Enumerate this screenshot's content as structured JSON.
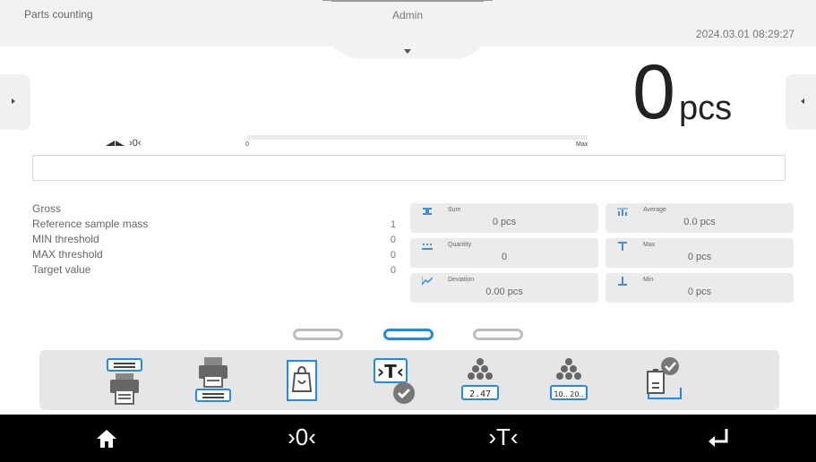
{
  "header": {
    "mode": "Parts counting",
    "user": "Admin",
    "datetime": "2024.03.01 08:29:27"
  },
  "result": {
    "value": "0",
    "unit": "pcs"
  },
  "indicators": {
    "zero": "›0‹"
  },
  "bargraph": {
    "min_label": "0",
    "max_label": "Max",
    "fill_fraction": 0
  },
  "info_rows": [
    {
      "label": "Gross",
      "value": ""
    },
    {
      "label": "Reference sample mass",
      "value": "1"
    },
    {
      "label": "MIN threshold",
      "value": "0"
    },
    {
      "label": "MAX threshold",
      "value": "0"
    },
    {
      "label": "Target value",
      "value": "0"
    }
  ],
  "tiles": [
    {
      "name": "Sum",
      "value": "0 pcs",
      "icon": "sum-icon"
    },
    {
      "name": "Average",
      "value": "0.0 pcs",
      "icon": "average-icon"
    },
    {
      "name": "Quantity",
      "value": "0",
      "icon": "quantity-icon"
    },
    {
      "name": "Max",
      "value": "0 pcs",
      "icon": "max-icon"
    },
    {
      "name": "Deviation",
      "value": "0.00 pcs",
      "icon": "deviation-icon"
    },
    {
      "name": "Min",
      "value": "0 pcs",
      "icon": "min-icon"
    }
  ],
  "pager": {
    "count": 3,
    "active": 1
  },
  "function_keys": [
    {
      "name": "print-header-icon"
    },
    {
      "name": "print-footer-icon"
    },
    {
      "name": "packaging-icon"
    },
    {
      "name": "tare-confirm-icon"
    },
    {
      "name": "set-part-mass-icon",
      "label": "2.47"
    },
    {
      "name": "determine-part-mass-icon",
      "label": "10.. 20.."
    },
    {
      "name": "product-confirm-icon"
    }
  ],
  "bottom_nav": [
    {
      "name": "home-icon"
    },
    {
      "name": "zero-icon",
      "glyph": "›0‹"
    },
    {
      "name": "tare-icon",
      "glyph": "›T‹"
    },
    {
      "name": "enter-icon"
    }
  ],
  "colors": {
    "accent": "#1d8cf0",
    "header_bg": "#f2f2f2",
    "tile_bg": "#ebebeb",
    "bar_bg": "#000000"
  }
}
